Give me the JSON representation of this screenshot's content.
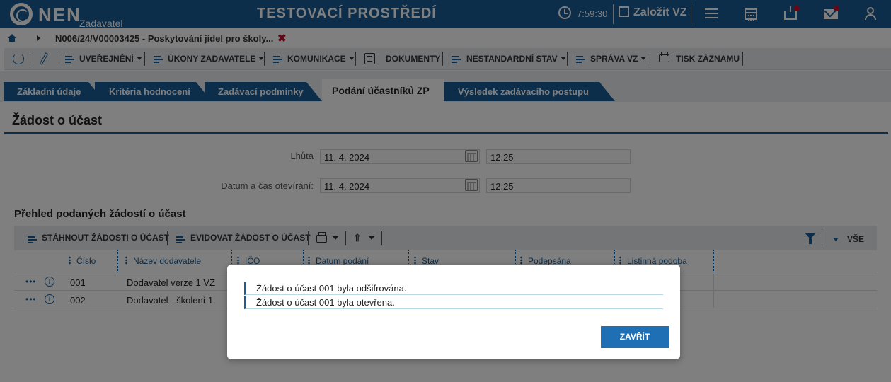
{
  "header": {
    "brand": "NEN",
    "brand_sub": "Zadavatel",
    "environment_title": "TESTOVACÍ PROSTŘEDÍ",
    "time": "7:59:30",
    "new_vz_label": "Založit VZ",
    "icons": [
      "clock-icon",
      "menu-icon",
      "calendar-icon",
      "inbox-icon",
      "mail-icon",
      "user-icon"
    ],
    "notification_color": "#c8102e"
  },
  "breadcrumb": {
    "text": "N006/24/V00003425 - Poskytování jídel pro školy..."
  },
  "toolbar": {
    "items": [
      {
        "label": "UVEŘEJNĚNÍ"
      },
      {
        "label": "ÚKONY ZADAVATELE"
      },
      {
        "label": "KOMUNIKACE"
      },
      {
        "label": "DOKUMENTY"
      },
      {
        "label": "NESTANDARDNÍ STAV"
      },
      {
        "label": "SPRÁVA VZ"
      },
      {
        "label": "TISK ZÁZNAMU"
      }
    ]
  },
  "tabs": [
    {
      "label": "Základní údaje"
    },
    {
      "label": "Kritéria hodnocení"
    },
    {
      "label": "Zadávací podmínky"
    },
    {
      "label": "Podání účastníků ZP",
      "active": true
    },
    {
      "label": "Výsledek zadávacího postupu"
    }
  ],
  "section": {
    "title": "Žádost o účast",
    "deadline_label": "Lhůta",
    "deadline_date": "11. 4. 2024",
    "deadline_time": "12:25",
    "opening_label": "Datum a čas otevírání:",
    "opening_date": "11. 4. 2024",
    "opening_time": "12:25"
  },
  "overview": {
    "title": "Přehled podaných žádostí o účast",
    "toolbar": {
      "download_label": "STÁHNOUT ŽÁDOSTI O ÚČAST",
      "register_label": "EVIDOVAT ŽÁDOST O ÚČAST",
      "filter_all_label": "VŠE"
    },
    "columns": [
      "Číslo",
      "Název dodavatele",
      "IČO",
      "Datum podání",
      "Stav",
      "Podepsána",
      "Listinná podoba"
    ],
    "rows": [
      {
        "number": "001",
        "supplier": "Dodavatel verze 1 VZ"
      },
      {
        "number": "002",
        "supplier": "Dodavatel - školení 1"
      }
    ]
  },
  "modal": {
    "messages": [
      "Žádost o účast 001 byla odšifrována.",
      "Žádost o účast 001 byla otevřena."
    ],
    "close_label": "ZAVŘÍT"
  },
  "colors": {
    "brand_blue": "#1b5c94",
    "button_blue": "#1f6fb5",
    "overlay": "rgba(0,0,0,0.5)"
  }
}
